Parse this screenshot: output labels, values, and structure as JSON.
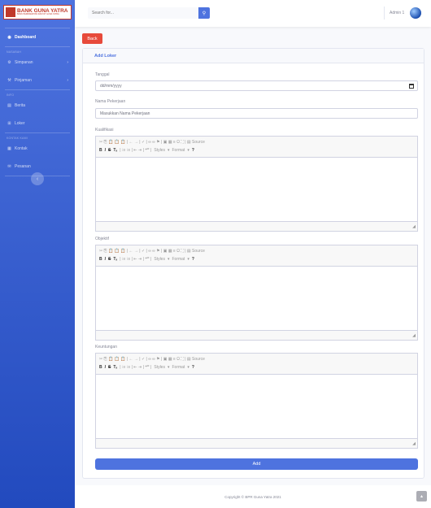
{
  "brand": {
    "name": "BANK GUNA YATRA",
    "subtitle": "BANK PERKREDITAN RAKYAT GUNA YATRA",
    "accent": "#c0392b"
  },
  "sidebar": {
    "dashboard": "Dashboard",
    "heading_nasabah": "Nasabah",
    "simpanan": "Simpanan",
    "pinjaman": "Pinjaman",
    "heading_info": "Info",
    "berita": "Berita",
    "loker": "Loker",
    "heading_kontak": "Kontak Kami",
    "kontak": "Kontak",
    "pesanan": "Pesanan",
    "toggle_icon": "‹"
  },
  "topbar": {
    "search_placeholder": "Search for...",
    "user_name": "Admin 1"
  },
  "back_label": "Back",
  "form": {
    "title": "Add Loker",
    "tanggal_label": "Tanggal",
    "tanggal_value": "dd/mm/yyyy",
    "nama_label": "Nama Pekerjaan",
    "nama_placeholder": "Masukkan Nama Pekerjaan",
    "kualifikasi_label": "Kualifikasi",
    "objektif_label": "Objektif",
    "keuntungan_label": "Keuntungan",
    "add_label": "Add"
  },
  "editor_toolbar": {
    "row1": "✂ ⎘ 📋 📋 📋 | ← → | ✓ | ∞ ∞ ⚑ | ▣ ▦ ≡ Ω ⛶ | ▤ Source",
    "b": "B",
    "i": "I",
    "s": "S",
    "tx": "Tₓ",
    "lists": "| ⁝≡ ⁝≡ | ⇤ ⇥ | ❝❞ |",
    "styles": "Styles",
    "format": "Format",
    "help": "?"
  },
  "footer": {
    "copyright": "Copyright © BPR Guna Yatra 2021"
  },
  "colors": {
    "primary": "#4e73df",
    "danger": "#e74a3b"
  }
}
